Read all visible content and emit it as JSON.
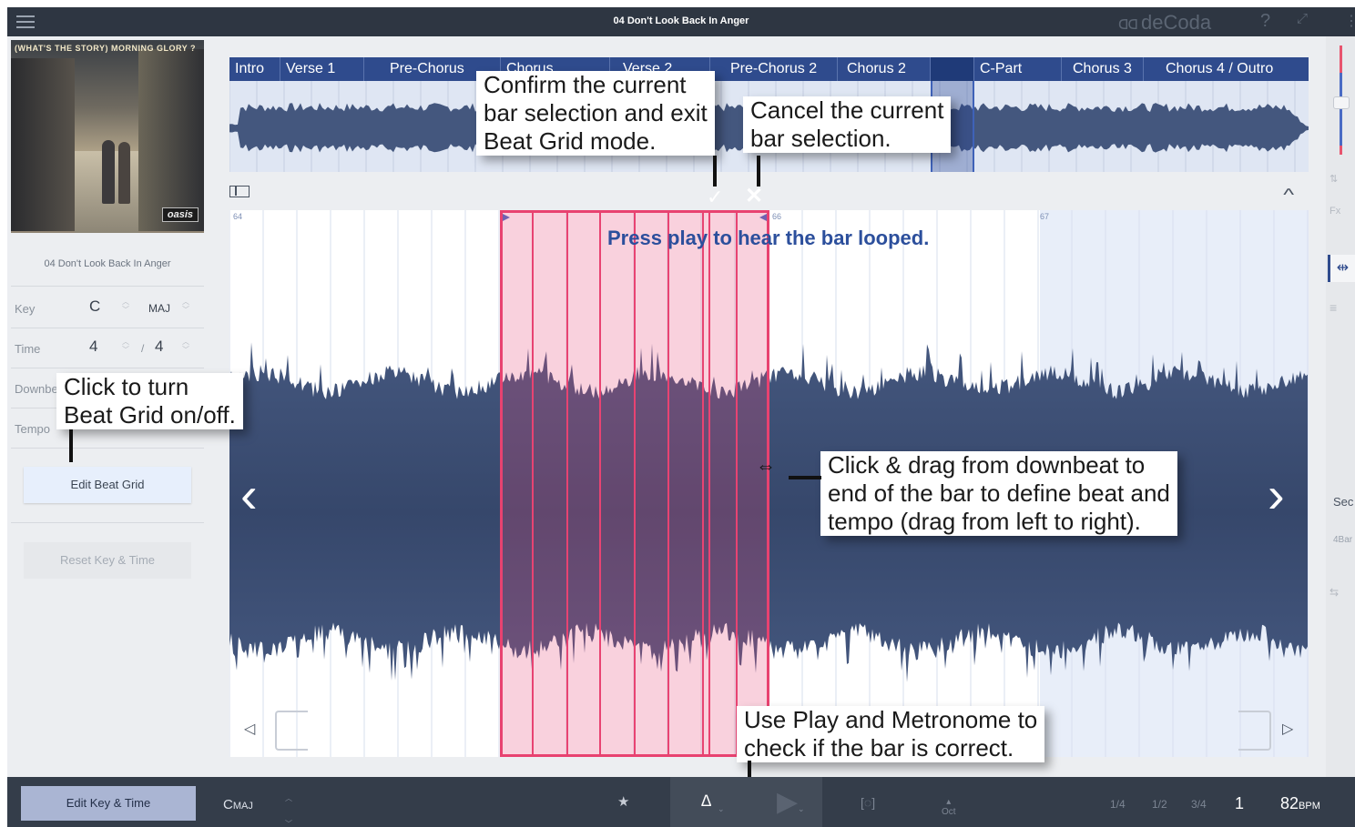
{
  "titlebar": {
    "track_title": "04 Don't Look Back In Anger",
    "logo_text": "deCoda",
    "logo_mark": "ᗡᗡ",
    "help_label": "?"
  },
  "left_panel": {
    "album_cover_text": "(WHAT'S THE STORY) MORNING GLORY ?",
    "album_brand": "oasis",
    "track_name": "04 Don't Look Back In Anger",
    "key_label": "Key",
    "key_note": "C",
    "key_mode": "MAJ",
    "time_label": "Time",
    "time_numerator": "4",
    "time_separator": "/",
    "time_denominator": "4",
    "downbeat_label": "Downbeat",
    "tempo_label": "Tempo",
    "edit_beat_grid": "Edit Beat Grid",
    "reset_key_time": "Reset Key & Time"
  },
  "sections": [
    {
      "label": "Intro",
      "active": false
    },
    {
      "label": "Verse 1",
      "active": false
    },
    {
      "label": "Pre-Chorus",
      "active": false
    },
    {
      "label": "Chorus",
      "active": false
    },
    {
      "label": "Verse 2",
      "active": false
    },
    {
      "label": "Pre-Chorus 2",
      "active": false
    },
    {
      "label": "Chorus 2",
      "active": false
    },
    {
      "label": "",
      "active": true
    },
    {
      "label": "C-Part",
      "active": false
    },
    {
      "label": "Chorus 3",
      "active": false
    },
    {
      "label": "Chorus 4 / Outro",
      "active": false
    }
  ],
  "main": {
    "hint": "Press play to hear the bar looped.",
    "bar_numbers": [
      "64",
      "66",
      "67"
    ]
  },
  "callouts": {
    "confirm": "Confirm the current\nbar selection and exit\nBeat Grid mode.",
    "cancel": "Cancel the current\nbar selection.",
    "beat_grid": "Click to turn\nBeat Grid on/off.",
    "drag": "Click & drag from downbeat to\nend of the bar to define beat and\ntempo (drag from left to right).",
    "play_metronome": "Use Play and Metronome to\ncheck if the bar is correct."
  },
  "right_panel": {
    "section_label": "Sec",
    "bars_label": "4Bar",
    "fx_label": "Fx"
  },
  "bottom_bar": {
    "edit_key_time": "Edit Key & Time",
    "key_note": "C",
    "key_mode": "MAJ",
    "oct_label": "Oct",
    "speeds": [
      "1/4",
      "1/2",
      "3/4"
    ],
    "speed_current": "1",
    "bpm_value": "82",
    "bpm_unit": "BPM"
  },
  "colors": {
    "accent": "#2f4b8d",
    "selection": "#e84270",
    "waveform": "#44577e"
  }
}
